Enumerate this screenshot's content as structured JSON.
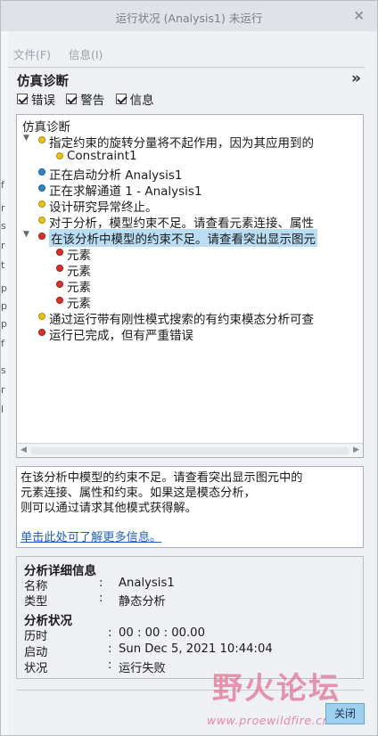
{
  "window": {
    "title": "运行状况 (Analysis1) 未运行",
    "close_glyph": "×"
  },
  "menu": {
    "file": "文件(F)",
    "info": "信息(I)"
  },
  "panel": {
    "title": "仿真诊断",
    "expand_glyph": "»"
  },
  "filters": {
    "errors": "错误",
    "warnings": "警告",
    "info": "信息"
  },
  "tree": [
    {
      "text": "仿真诊断",
      "level": 0,
      "dot": "",
      "toggle": false,
      "selected": false
    },
    {
      "text": "指定约束的旋转分量将不起作用，因为其应用到的",
      "level": 1,
      "dot": "yellow",
      "toggle": true,
      "selected": false
    },
    {
      "text": "Constraint1",
      "level": 2,
      "dot": "yellow",
      "toggle": false,
      "selected": false
    },
    {
      "text": "正在启动分析 Analysis1",
      "level": 1,
      "dot": "blue",
      "toggle": false,
      "selected": false
    },
    {
      "text": "正在求解通道 1 - Analysis1",
      "level": 1,
      "dot": "blue",
      "toggle": false,
      "selected": false
    },
    {
      "text": "设计研究异常终止。",
      "level": 1,
      "dot": "yellow",
      "toggle": false,
      "selected": false
    },
    {
      "text": "对于分析，模型约束不足。请查看元素连接、属性",
      "level": 1,
      "dot": "yellow",
      "toggle": false,
      "selected": false
    },
    {
      "text": "在该分析中模型的约束不足。请查看突出显示图元",
      "level": 1,
      "dot": "red",
      "toggle": true,
      "selected": true
    },
    {
      "text": "元素",
      "level": 2,
      "dot": "red",
      "toggle": false,
      "selected": false
    },
    {
      "text": "元素",
      "level": 2,
      "dot": "red",
      "toggle": false,
      "selected": false
    },
    {
      "text": "元素",
      "level": 2,
      "dot": "red",
      "toggle": false,
      "selected": false
    },
    {
      "text": "元素",
      "level": 2,
      "dot": "red",
      "toggle": false,
      "selected": false
    },
    {
      "text": "通过运行带有刚性模式搜索的有约束模态分析可查",
      "level": 1,
      "dot": "yellow",
      "toggle": false,
      "selected": false
    },
    {
      "text": "运行已完成，但有严重错误",
      "level": 1,
      "dot": "red",
      "toggle": false,
      "selected": false
    }
  ],
  "description": {
    "text": "在该分析中模型的约束不足。请查看突出显示图元中的\n元素连接、属性和约束。如果这是模态分析，\n则可以通过请求其他模式获得解。",
    "link": "单击此处可了解更多信息。"
  },
  "details": {
    "title": "分析详细信息",
    "name_label": "名称",
    "name_value": "Analysis1",
    "type_label": "类型",
    "type_value": "静态分析",
    "status_title": "分析状况",
    "elapsed_label": "历时",
    "elapsed_value": "00 : 00 : 00.00",
    "start_label": "启动",
    "start_value": "Sun Dec  5, 2021   10:44:04",
    "state_label": "状况",
    "state_value": "运行失败",
    "sep": ":"
  },
  "buttons": {
    "close": "关闭"
  },
  "watermark": {
    "cn": "野火论坛",
    "en": "www.proewildfire.cn"
  },
  "edge_glyphs": [
    "f",
    "r",
    "s",
    "r",
    "t",
    "p",
    "p",
    "p",
    "f",
    "s",
    "r",
    "l"
  ]
}
